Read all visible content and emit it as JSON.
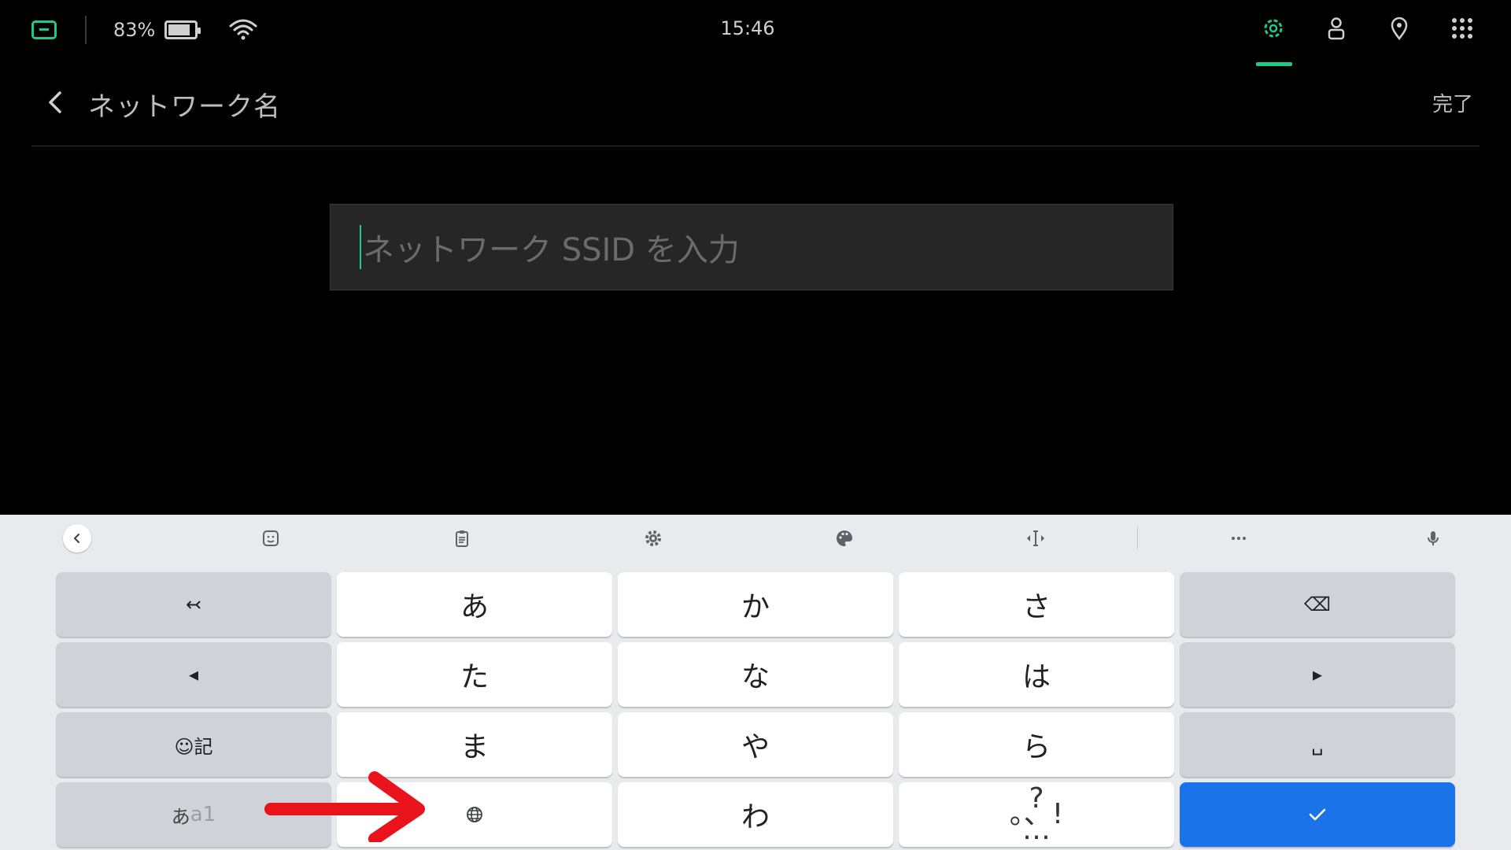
{
  "status_bar": {
    "battery_percent": "83%",
    "time": "15:46",
    "accent_color": "#1ec98a",
    "icons": [
      "app-icon",
      "battery-icon",
      "wifi-icon",
      "settings-icon",
      "account-icon",
      "location-icon",
      "apps-grid-icon"
    ]
  },
  "header": {
    "title": "ネットワーク名",
    "done_label": "完了"
  },
  "ssid_field": {
    "placeholder": "ネットワーク SSID を入力",
    "value": ""
  },
  "keyboard": {
    "toolbar_icons": [
      "collapse-icon",
      "sticker-icon",
      "clipboard-icon",
      "settings-icon",
      "palette-icon",
      "cursor-move-icon",
      "more-icon",
      "microphone-icon"
    ],
    "keys": {
      "undo": "↢",
      "a": "あ",
      "ka": "か",
      "sa": "さ",
      "backspace": "⌫",
      "left": "◂",
      "ta": "た",
      "na": "な",
      "ha": "は",
      "right": "▸",
      "emoji_symbol": "☺記",
      "ma": "ま",
      "ya": "や",
      "ra": "ら",
      "space": "␣",
      "mode_kana": "あ",
      "mode_alnum": "a1",
      "globe": "🌐",
      "wa": "わ",
      "punct_top": "?",
      "punct_mid": "。、!",
      "punct_bottom": "…",
      "enter": "✓"
    },
    "enter_color": "#1a73e8"
  },
  "annotation": {
    "arrow_color": "#e8131b",
    "points_to": "globe-key"
  }
}
